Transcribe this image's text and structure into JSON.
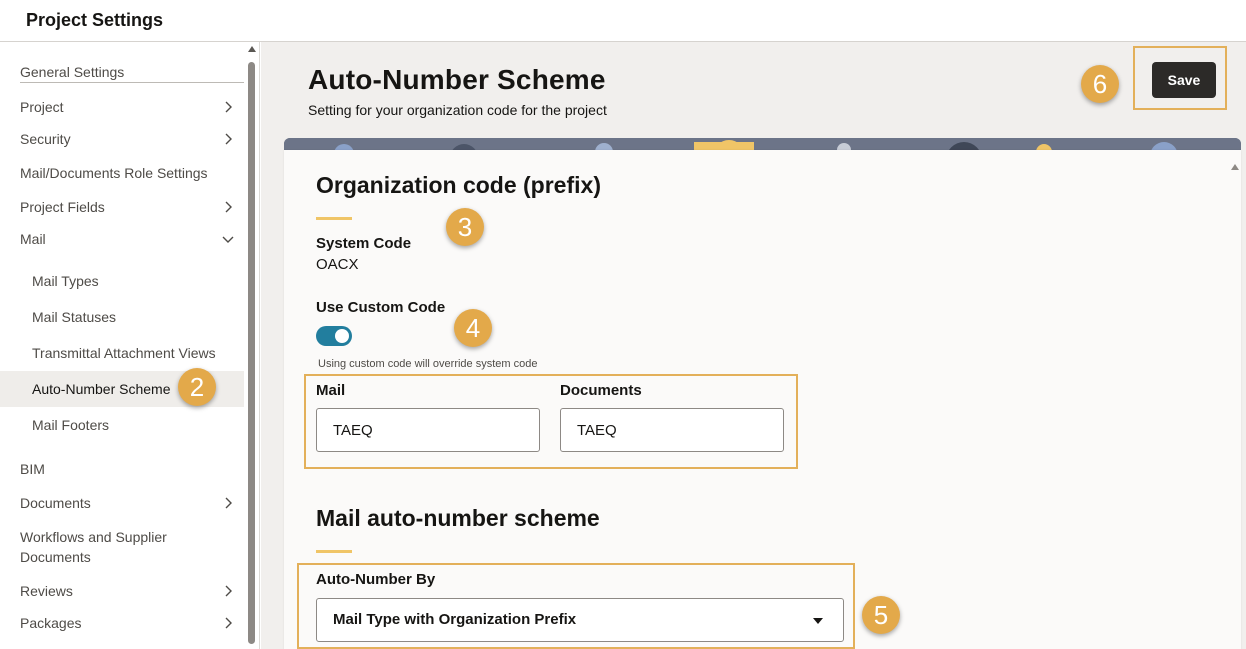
{
  "app": {
    "title": "Project Settings"
  },
  "sidebar": {
    "items": [
      {
        "label": "General Settings"
      },
      {
        "label": "Project"
      },
      {
        "label": "Security"
      },
      {
        "label": "Mail/Documents Role Settings"
      },
      {
        "label": "Project Fields"
      },
      {
        "label": "Mail"
      },
      {
        "label": "Mail Types"
      },
      {
        "label": "Mail Statuses"
      },
      {
        "label": "Transmittal Attachment Views"
      },
      {
        "label": "Auto-Number Scheme"
      },
      {
        "label": "Mail Footers"
      },
      {
        "label": "BIM"
      },
      {
        "label": "Documents"
      },
      {
        "label": "Workflows and Supplier Documents"
      },
      {
        "label": "Reviews"
      },
      {
        "label": "Packages"
      }
    ],
    "selected": "Auto-Number Scheme"
  },
  "header": {
    "title": "Auto-Number Scheme",
    "subtitle": "Setting for your organization code for the project",
    "save_label": "Save"
  },
  "badges": [
    "2",
    "3",
    "4",
    "5",
    "6"
  ],
  "org_code": {
    "heading": "Organization code (prefix)",
    "system_code_label": "System Code",
    "system_code_value": "OACX",
    "custom_code_label": "Use Custom Code",
    "custom_code_enabled": true,
    "custom_code_hint": "Using custom code will override system code",
    "mail_label": "Mail",
    "mail_value": "TAEQ",
    "documents_label": "Documents",
    "documents_value": "TAEQ"
  },
  "mail_scheme": {
    "heading": "Mail auto-number scheme",
    "auto_number_label": "Auto-Number By",
    "auto_number_value": "Mail Type with Organization Prefix"
  },
  "colors": {
    "accent": "#f0c567",
    "highlight_outline": "#e3b05a",
    "badge": "#e3a94a",
    "toggle_on": "#227e9e",
    "primary_button": "#2c2a28"
  }
}
